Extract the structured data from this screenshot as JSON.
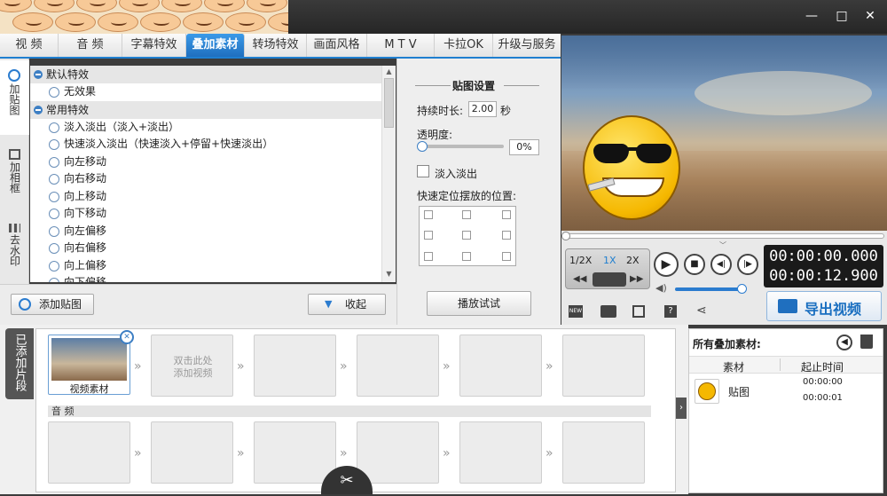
{
  "window": {
    "minimize": "—",
    "maximize": "□",
    "close": "✕"
  },
  "tabs": [
    "视 频",
    "音 频",
    "字幕特效",
    "叠加素材",
    "转场特效",
    "画面风格",
    "M T V",
    "卡拉OK",
    "升级与服务"
  ],
  "active_tab": "叠加素材",
  "side_tabs": [
    "加贴图",
    "加相框",
    "去水印"
  ],
  "effects": {
    "groups": [
      {
        "title": "默认特效",
        "items": [
          "无效果"
        ]
      },
      {
        "title": "常用特效",
        "items": [
          "淡入淡出（淡入+淡出）",
          "快速淡入淡出（快速淡入+停留+快速淡出）",
          "向左移动",
          "向右移动",
          "向上移动",
          "向下移动",
          "向左偏移",
          "向右偏移",
          "向上偏移",
          "向下偏移"
        ]
      }
    ]
  },
  "buttons": {
    "add_sticker": "添加贴图",
    "collapse": "收起",
    "play_test": "播放试试",
    "export": "导出视频"
  },
  "settings": {
    "title": "贴图设置",
    "duration_label": "持续时长:",
    "duration_value": "2.00",
    "duration_unit": "秒",
    "opacity_label": "透明度:",
    "opacity_value": "0%",
    "fade_label": "淡入淡出",
    "position_label": "快速定位摆放的位置:"
  },
  "player": {
    "speeds": [
      "1/2X",
      "1X",
      "2X"
    ],
    "current_time": "00:00:00.000",
    "total_time": "00:00:12.900"
  },
  "timeline": {
    "side_label": "已添加片段",
    "video_clip_label": "视频素材",
    "add_video_hint_1": "双击此处",
    "add_video_hint_2": "添加视频",
    "audio_label": "音 频"
  },
  "overlay_panel": {
    "title": "所有叠加素材:",
    "col_material": "素材",
    "col_start": "起止时间",
    "rows": [
      {
        "name": "贴图",
        "start": "00:00:00",
        "end": "00:00:01"
      }
    ]
  },
  "colors": {
    "accent": "#1f7fd0",
    "export_text": "#1a6fc0"
  }
}
